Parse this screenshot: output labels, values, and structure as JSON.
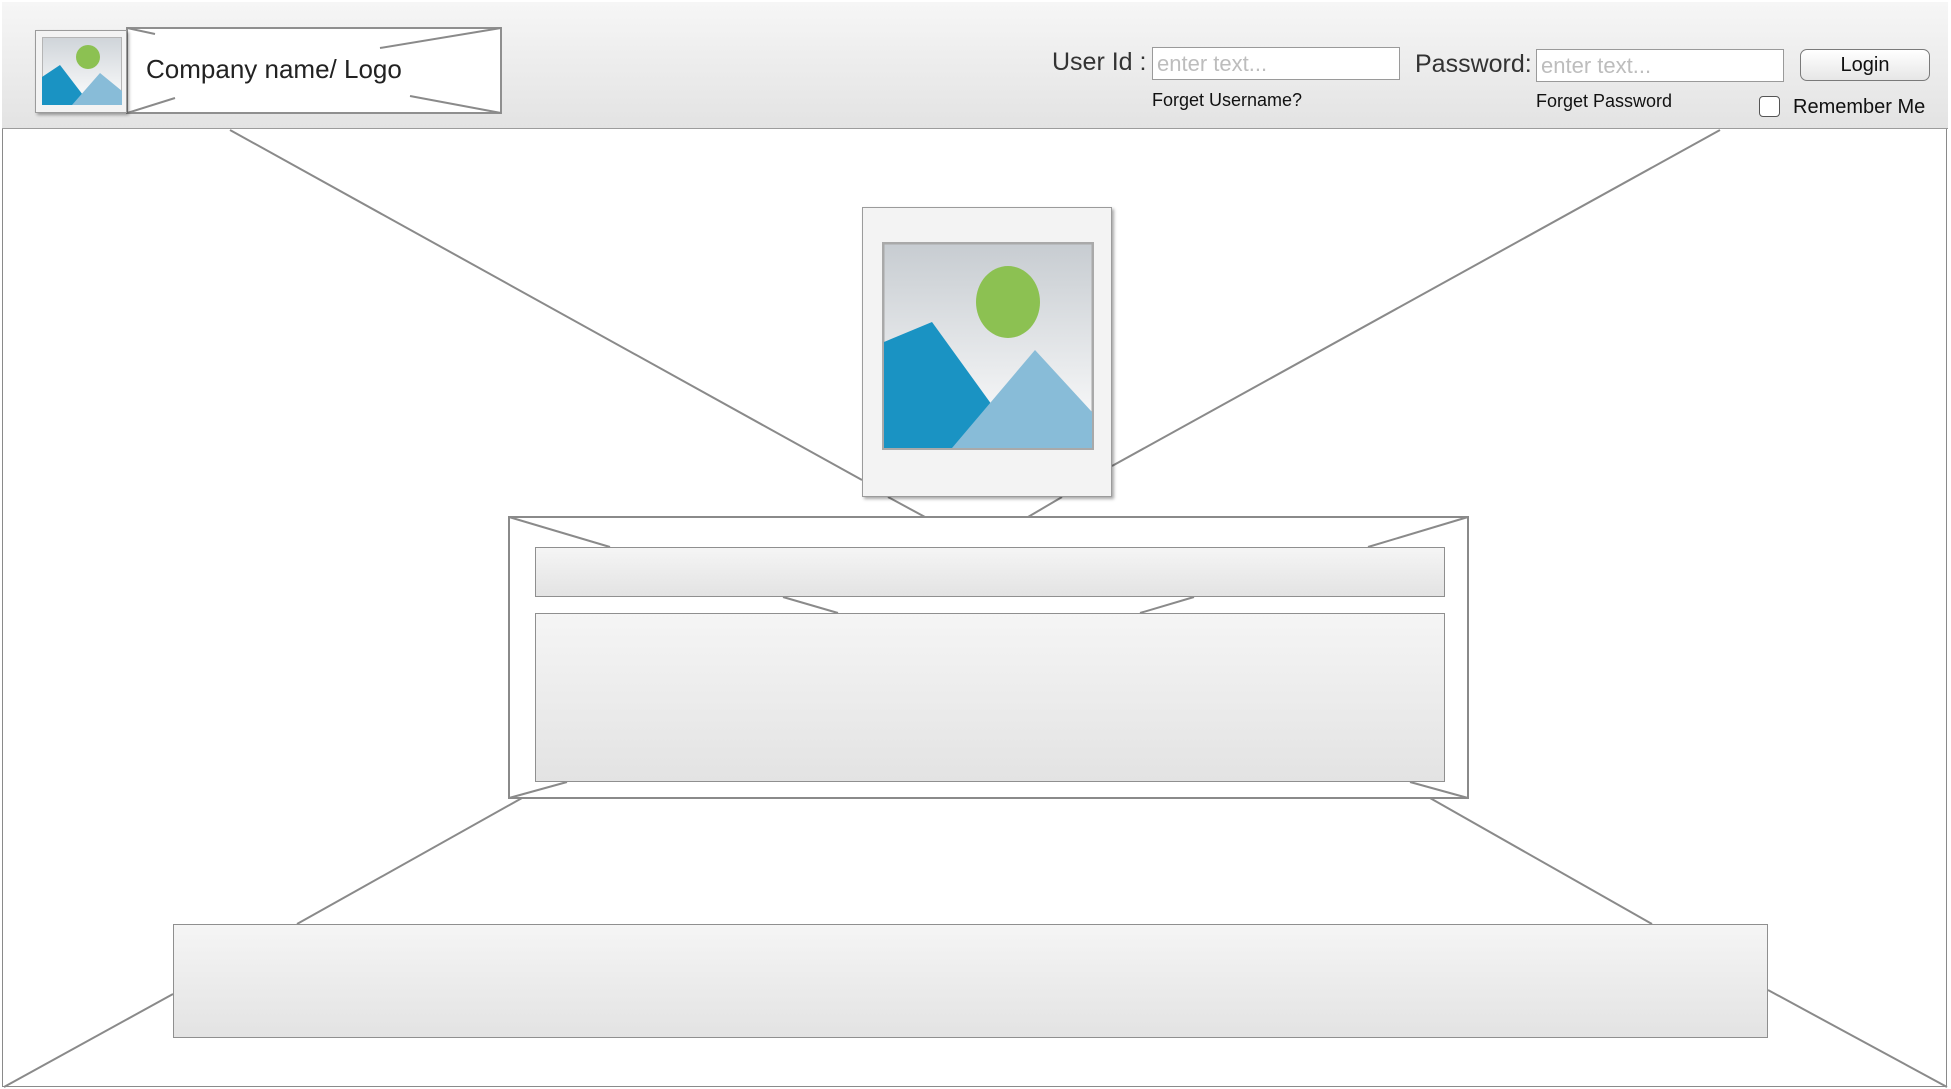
{
  "header": {
    "logo_text": "Company name/ Logo",
    "logo_icon": "image-placeholder-icon"
  },
  "login": {
    "user_label": "User Id :",
    "user_placeholder": "enter text...",
    "forgot_username": "Forget Username?",
    "password_label": "Password:",
    "password_placeholder": "enter text...",
    "forgot_password": "Forget Password",
    "login_button": "Login",
    "remember_me": "Remember Me"
  },
  "hero": {
    "icon": "image-placeholder-icon"
  },
  "colors": {
    "mountain_dark": "#1a93c3",
    "mountain_light": "#88bcd8",
    "sun": "#8cc152"
  }
}
